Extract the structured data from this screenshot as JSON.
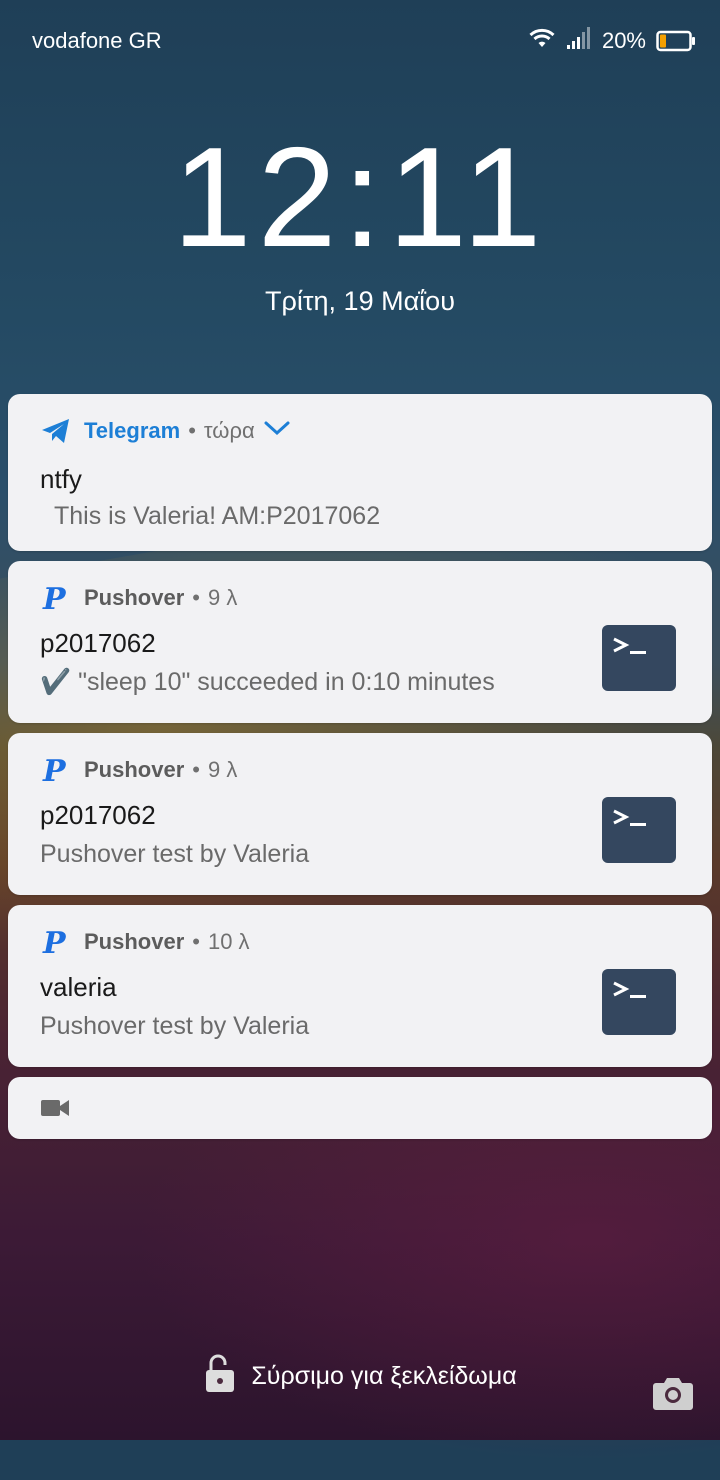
{
  "status_bar": {
    "carrier": "vodafone GR",
    "battery_percent": "20%",
    "icons": [
      "wifi-icon",
      "signal-icon",
      "battery-icon"
    ]
  },
  "lockscreen": {
    "time": "12:11",
    "date": "Τρίτη, 19 Μαΐου",
    "unlock_hint": "Σύρσιμο για ξεκλείδωμα"
  },
  "notifications": [
    {
      "app": "Telegram",
      "time": "τώρα",
      "title": "ntfy",
      "body": "This is Valeria! AM:P2017062",
      "app_color": "#1d7fd6",
      "icon": "telegram-icon",
      "expand_icon": "chevron-down-icon"
    },
    {
      "app": "Pushover",
      "time": "9 λ",
      "title": "p2017062",
      "body": "✔️ \"sleep 10\" succeeded in 0:10 minutes",
      "icon": "pushover-icon",
      "thumbnail": "terminal-icon"
    },
    {
      "app": "Pushover",
      "time": "9 λ",
      "title": "p2017062",
      "body": "Pushover test by Valeria",
      "icon": "pushover-icon",
      "thumbnail": "terminal-icon"
    },
    {
      "app": "Pushover",
      "time": "10 λ",
      "title": "valeria",
      "body": "Pushover test by Valeria",
      "icon": "pushover-icon",
      "thumbnail": "terminal-icon"
    },
    {
      "icon": "video-camera-icon"
    }
  ],
  "colors": {
    "pushover_blue": "#1d6fe0",
    "thumb_bg": "#34475f",
    "card_bg": "#f2f2f4"
  }
}
